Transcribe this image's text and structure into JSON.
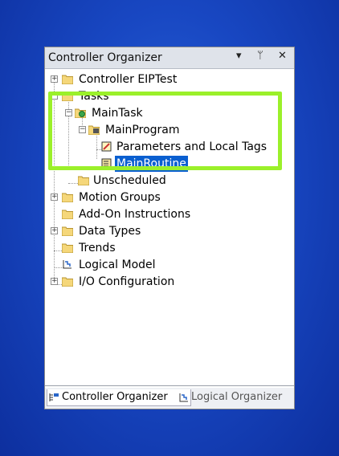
{
  "panel": {
    "title": "Controller Organizer",
    "controls": {
      "dropdown": "▾",
      "pin": "ᛘ",
      "close": "✕"
    }
  },
  "tree": {
    "controller": "Controller EIPTest",
    "tasks": "Tasks",
    "main_task": "MainTask",
    "main_program": "MainProgram",
    "parameters": "Parameters and Local Tags",
    "main_routine": "MainRoutine",
    "unscheduled": "Unscheduled",
    "motion_groups": "Motion Groups",
    "add_on": "Add-On Instructions",
    "data_types": "Data Types",
    "trends": "Trends",
    "logical_model": "Logical Model",
    "io_config": "I/O Configuration"
  },
  "tabs": {
    "controller_organizer": "Controller Organizer",
    "logical_organizer": "Logical Organizer"
  },
  "colors": {
    "highlight": "#9bf02a",
    "selection": "#0a5fd0",
    "folder": "#f5d77a"
  }
}
